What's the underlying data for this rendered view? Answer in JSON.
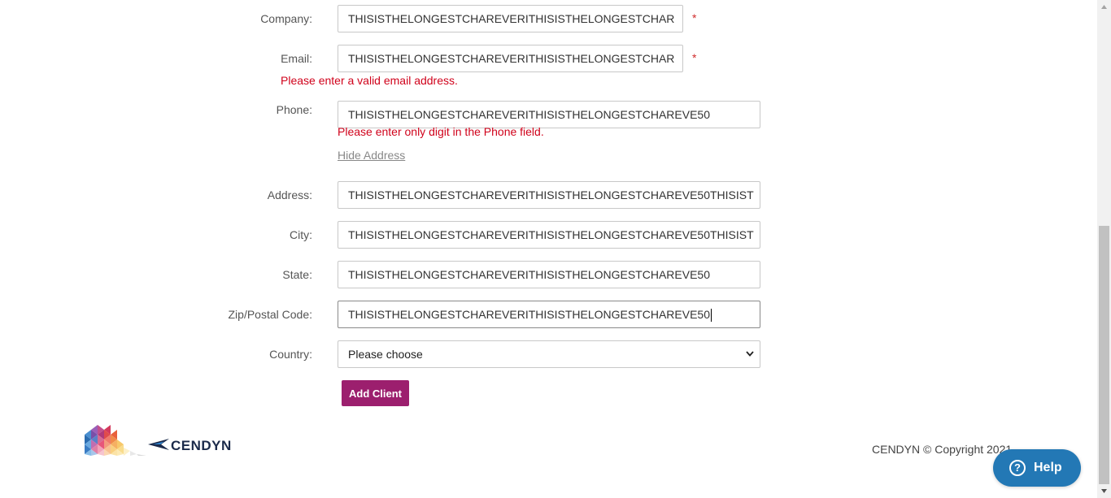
{
  "form": {
    "company": {
      "label": "Company:",
      "value": "THISISTHELONGESTCHAREVERITHISISTHELONGESTCHAR",
      "required_mark": "*"
    },
    "email": {
      "label": "Email:",
      "value": "THISISTHELONGESTCHAREVERITHISISTHELONGESTCHAR",
      "required_mark": "*",
      "error": "Please enter a valid email address."
    },
    "phone": {
      "label": "Phone:",
      "value": "THISISTHELONGESTCHAREVERITHISISTHELONGESTCHAREVE50",
      "error": "Please enter only digit in the Phone field."
    },
    "hide_address_label": "Hide Address",
    "address": {
      "label": "Address:",
      "value": "THISISTHELONGESTCHAREVERITHISISTHELONGESTCHAREVE50THISIST"
    },
    "city": {
      "label": "City:",
      "value": "THISISTHELONGESTCHAREVERITHISISTHELONGESTCHAREVE50THISIST"
    },
    "state": {
      "label": "State:",
      "value": "THISISTHELONGESTCHAREVERITHISISTHELONGESTCHAREVE50"
    },
    "zip": {
      "label": "Zip/Postal Code:",
      "value": "THISISTHELONGESTCHAREVERITHISISTHELONGESTCHAREVE50"
    },
    "country": {
      "label": "Country:",
      "selected": "Please choose"
    },
    "submit_label": "Add Client"
  },
  "footer": {
    "brand": "CENDYN",
    "copyright": "CENDYN © Copyright 2021"
  },
  "help": {
    "label": "Help",
    "icon": "question-circle-icon"
  },
  "colors": {
    "accent": "#9c1f6e",
    "error": "#d0021b",
    "help": "#2378b5"
  }
}
